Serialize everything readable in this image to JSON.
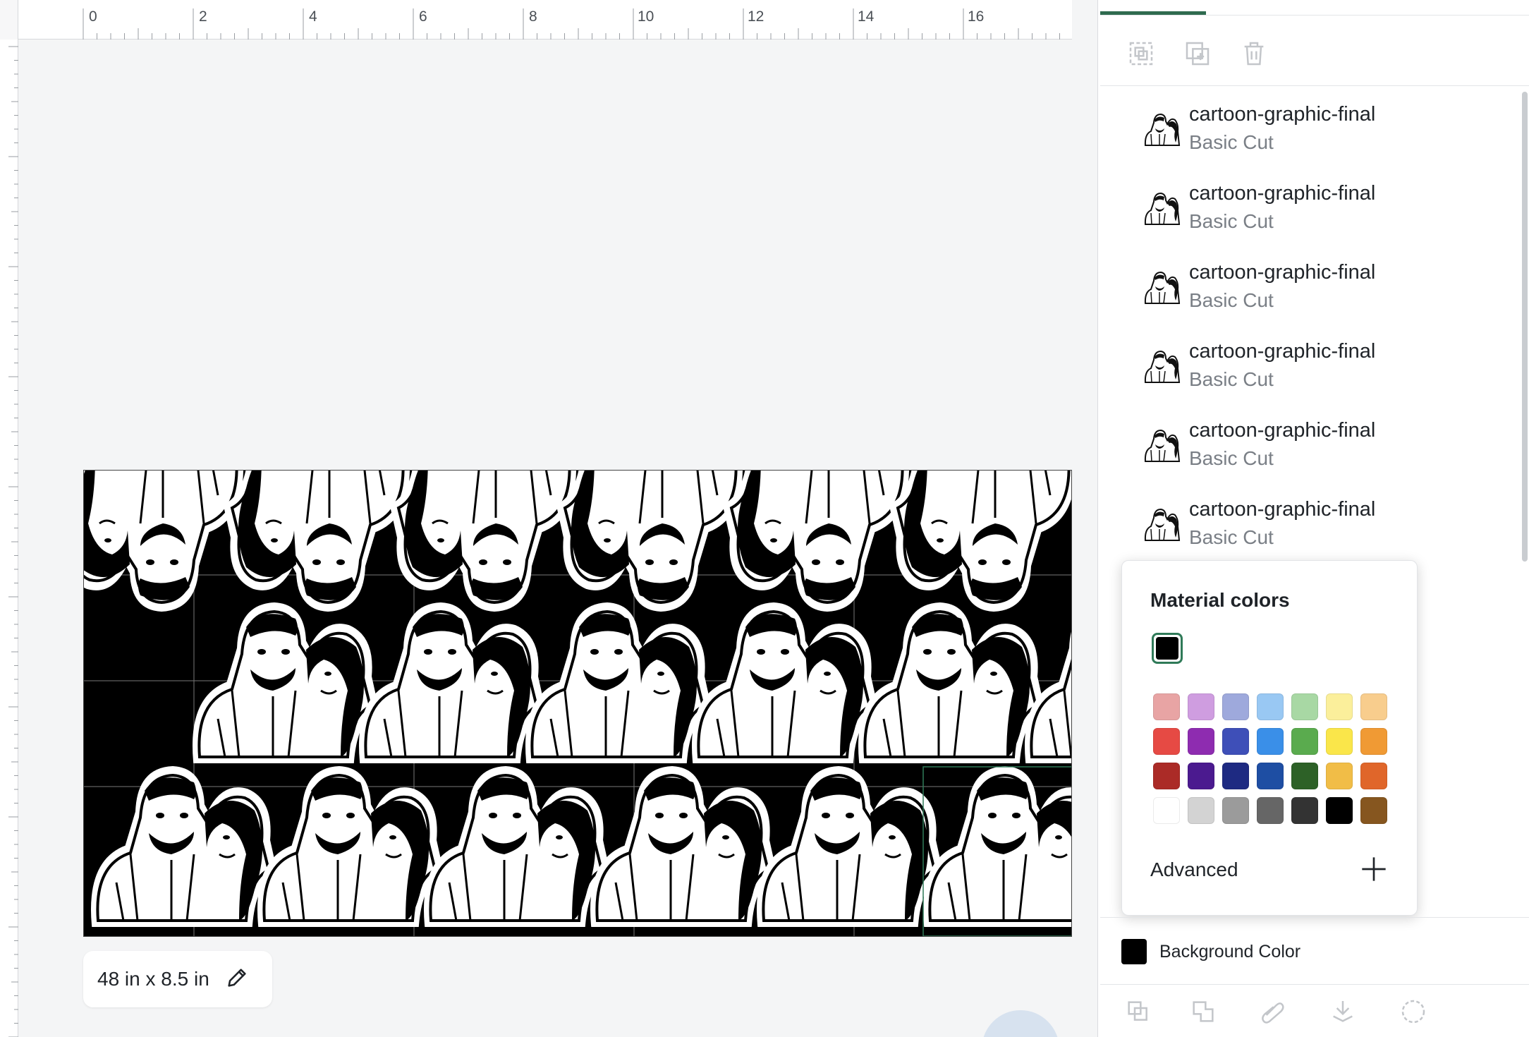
{
  "ruler": {
    "labels": [
      "0",
      "2",
      "4",
      "6",
      "8",
      "10",
      "12",
      "14",
      "16"
    ]
  },
  "canvas": {
    "size_label": "48 in x 8.5 in",
    "background_color": "#000000"
  },
  "toolbar": {
    "icons": [
      "group-icon",
      "duplicate-icon",
      "delete-icon"
    ]
  },
  "layers": [
    {
      "name": "cartoon-graphic-final",
      "type": "Basic Cut"
    },
    {
      "name": "cartoon-graphic-final",
      "type": "Basic Cut"
    },
    {
      "name": "cartoon-graphic-final",
      "type": "Basic Cut"
    },
    {
      "name": "cartoon-graphic-final",
      "type": "Basic Cut"
    },
    {
      "name": "cartoon-graphic-final",
      "type": "Basic Cut"
    },
    {
      "name": "cartoon-graphic-final",
      "type": "Basic Cut"
    }
  ],
  "material_colors": {
    "title": "Material colors",
    "selected": "#000000",
    "palette": [
      "#e8a4a4",
      "#cf9de0",
      "#9ea9dc",
      "#99c8f3",
      "#a8d8a4",
      "#fbef9b",
      "#f8cd8d",
      "#e64a44",
      "#8e2cb0",
      "#3e4fb8",
      "#3a8fe8",
      "#5aab4e",
      "#fae64a",
      "#f09a34",
      "#ab2b27",
      "#4b1a8f",
      "#1e2a82",
      "#1e4ea3",
      "#2d6127",
      "#f1bd47",
      "#e0662a",
      "#ffffff",
      "#d3d3d3",
      "#9b9b9b",
      "#666666",
      "#333333",
      "#000000",
      "#86561f"
    ],
    "advanced_label": "Advanced"
  },
  "background": {
    "label": "Background Color",
    "color": "#000000"
  },
  "bottom_bar": {
    "icons": [
      "slice-icon",
      "combine-icon",
      "attach-icon",
      "flatten-icon",
      "contour-icon"
    ]
  },
  "accent": "#2f6b4f"
}
